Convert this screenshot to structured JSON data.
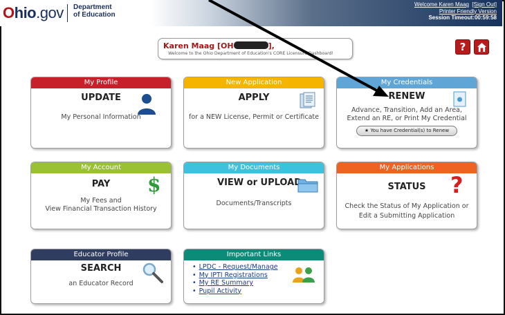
{
  "header": {
    "logo_o": "O",
    "logo_hio": "hio",
    "logo_gov": ".gov",
    "dept_line1": "Department",
    "dept_line2": "of Education",
    "welcome_link": "Welcome  Karen Maag",
    "sign_out": "[Sign Out]",
    "printer_friendly": "Printer Friendly Version",
    "session_timeout": "Session Timeout:00:59:58"
  },
  "welcome": {
    "name_prefix": "Karen Maag [OH",
    "name_suffix": "],",
    "message": "Welcome to the Ohio Department of Education's CORE Licensure Dashboard!"
  },
  "corner": {
    "help_label": "?",
    "help_icon": "help-icon",
    "home_icon": "home-icon"
  },
  "tiles": {
    "profile": {
      "header": "My Profile",
      "title": "UPDATE",
      "sub": "My Personal Information"
    },
    "new_app": {
      "header": "New Application",
      "title": "APPLY",
      "sub": "for a NEW License, Permit or Certificate"
    },
    "credentials": {
      "header": "My Credentials",
      "title": "RENEW",
      "sub1": "Advance, Transition, Add an Area,",
      "sub2": "Extend an RE, or Print My Credential",
      "button": "You have Credential(s) to Renew"
    },
    "account": {
      "header": "My Account",
      "title": "PAY",
      "sub1": "My Fees and",
      "sub2": "View Financial Transaction History"
    },
    "documents": {
      "header": "My Documents",
      "title": "VIEW or UPLOAD",
      "sub": "Documents/Transcripts"
    },
    "applications": {
      "header": "My Applications",
      "title": "STATUS",
      "sub1": "Check the Status of My Application or",
      "sub2": "Edit a Submitting Application"
    },
    "educator": {
      "header": "Educator Profile",
      "title": "SEARCH",
      "sub": "an Educator Record"
    },
    "links": {
      "header": "Important Links",
      "items": [
        "LPDC - Request/Manage",
        "My IPTI Registrations",
        "My RE Summary",
        "Pupil Activity"
      ]
    }
  },
  "colors": {
    "red": "#c8202b",
    "orange": "#f4b400",
    "blue": "#5fa5d6",
    "green": "#9ac133",
    "cyan": "#3ec1df",
    "orange2": "#ef6322",
    "navy": "#2f3d61",
    "teal": "#0d8b79"
  }
}
